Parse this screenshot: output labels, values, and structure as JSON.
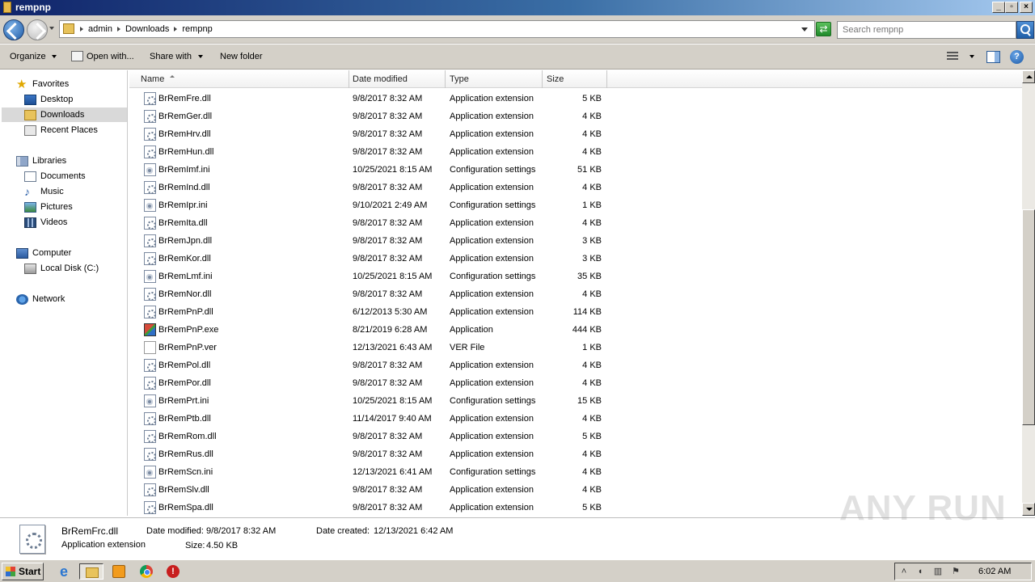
{
  "window": {
    "title": "rempnp"
  },
  "address": {
    "crumbs": [
      "admin",
      "Downloads",
      "rempnp"
    ],
    "search_placeholder": "Search rempnp"
  },
  "toolbar": {
    "organize": "Organize",
    "open_with": "Open with...",
    "share_with": "Share with",
    "new_folder": "New folder"
  },
  "nav": {
    "favorites": "Favorites",
    "desktop": "Desktop",
    "downloads": "Downloads",
    "recent": "Recent Places",
    "libraries": "Libraries",
    "documents": "Documents",
    "music": "Music",
    "pictures": "Pictures",
    "videos": "Videos",
    "computer": "Computer",
    "local_disk": "Local Disk (C:)",
    "network": "Network"
  },
  "columns": {
    "name": "Name",
    "date": "Date modified",
    "type": "Type",
    "size": "Size"
  },
  "files": [
    {
      "name": "BrRemFre.dll",
      "date": "9/8/2017 8:32 AM",
      "type": "Application extension",
      "size": "5 KB",
      "kind": "dll"
    },
    {
      "name": "BrRemGer.dll",
      "date": "9/8/2017 8:32 AM",
      "type": "Application extension",
      "size": "4 KB",
      "kind": "dll"
    },
    {
      "name": "BrRemHrv.dll",
      "date": "9/8/2017 8:32 AM",
      "type": "Application extension",
      "size": "4 KB",
      "kind": "dll"
    },
    {
      "name": "BrRemHun.dll",
      "date": "9/8/2017 8:32 AM",
      "type": "Application extension",
      "size": "4 KB",
      "kind": "dll"
    },
    {
      "name": "BrRemImf.ini",
      "date": "10/25/2021 8:15 AM",
      "type": "Configuration settings",
      "size": "51 KB",
      "kind": "ini"
    },
    {
      "name": "BrRemInd.dll",
      "date": "9/8/2017 8:32 AM",
      "type": "Application extension",
      "size": "4 KB",
      "kind": "dll"
    },
    {
      "name": "BrRemIpr.ini",
      "date": "9/10/2021 2:49 AM",
      "type": "Configuration settings",
      "size": "1 KB",
      "kind": "ini"
    },
    {
      "name": "BrRemIta.dll",
      "date": "9/8/2017 8:32 AM",
      "type": "Application extension",
      "size": "4 KB",
      "kind": "dll"
    },
    {
      "name": "BrRemJpn.dll",
      "date": "9/8/2017 8:32 AM",
      "type": "Application extension",
      "size": "3 KB",
      "kind": "dll"
    },
    {
      "name": "BrRemKor.dll",
      "date": "9/8/2017 8:32 AM",
      "type": "Application extension",
      "size": "3 KB",
      "kind": "dll"
    },
    {
      "name": "BrRemLmf.ini",
      "date": "10/25/2021 8:15 AM",
      "type": "Configuration settings",
      "size": "35 KB",
      "kind": "ini"
    },
    {
      "name": "BrRemNor.dll",
      "date": "9/8/2017 8:32 AM",
      "type": "Application extension",
      "size": "4 KB",
      "kind": "dll"
    },
    {
      "name": "BrRemPnP.dll",
      "date": "6/12/2013 5:30 AM",
      "type": "Application extension",
      "size": "114 KB",
      "kind": "dll"
    },
    {
      "name": "BrRemPnP.exe",
      "date": "8/21/2019 6:28 AM",
      "type": "Application",
      "size": "444 KB",
      "kind": "exe"
    },
    {
      "name": "BrRemPnP.ver",
      "date": "12/13/2021 6:43 AM",
      "type": "VER File",
      "size": "1 KB",
      "kind": "ver"
    },
    {
      "name": "BrRemPol.dll",
      "date": "9/8/2017 8:32 AM",
      "type": "Application extension",
      "size": "4 KB",
      "kind": "dll"
    },
    {
      "name": "BrRemPor.dll",
      "date": "9/8/2017 8:32 AM",
      "type": "Application extension",
      "size": "4 KB",
      "kind": "dll"
    },
    {
      "name": "BrRemPrt.ini",
      "date": "10/25/2021 8:15 AM",
      "type": "Configuration settings",
      "size": "15 KB",
      "kind": "ini"
    },
    {
      "name": "BrRemPtb.dll",
      "date": "11/14/2017 9:40 AM",
      "type": "Application extension",
      "size": "4 KB",
      "kind": "dll"
    },
    {
      "name": "BrRemRom.dll",
      "date": "9/8/2017 8:32 AM",
      "type": "Application extension",
      "size": "5 KB",
      "kind": "dll"
    },
    {
      "name": "BrRemRus.dll",
      "date": "9/8/2017 8:32 AM",
      "type": "Application extension",
      "size": "4 KB",
      "kind": "dll"
    },
    {
      "name": "BrRemScn.ini",
      "date": "12/13/2021 6:41 AM",
      "type": "Configuration settings",
      "size": "4 KB",
      "kind": "ini"
    },
    {
      "name": "BrRemSlv.dll",
      "date": "9/8/2017 8:32 AM",
      "type": "Application extension",
      "size": "4 KB",
      "kind": "dll"
    },
    {
      "name": "BrRemSpa.dll",
      "date": "9/8/2017 8:32 AM",
      "type": "Application extension",
      "size": "5 KB",
      "kind": "dll"
    }
  ],
  "details": {
    "name": "BrRemFrc.dll",
    "type": "Application extension",
    "modified_label": "Date modified:",
    "modified": "9/8/2017 8:32 AM",
    "created_label": "Date created:",
    "created": "12/13/2021 6:42 AM",
    "size_label": "Size:",
    "size": "4.50 KB"
  },
  "watermark": "ANY RUN",
  "taskbar": {
    "start": "Start",
    "clock": "6:02 AM"
  },
  "icons": {
    "favorites": "star-icon",
    "desktop": "desktop-icon",
    "downloads": "folder-icon",
    "recent": "recent-places-icon",
    "libraries": "library-icon",
    "documents": "documents-icon",
    "music": "music-icon",
    "pictures": "pictures-icon",
    "videos": "videos-icon",
    "computer": "computer-icon",
    "local_disk": "disk-icon",
    "network": "network-icon"
  },
  "colors": {
    "titlebar_start": "#10246a",
    "titlebar_end": "#a6caf0",
    "chrome_bg": "#d4d0c8",
    "selection": "#d9d9d9"
  }
}
